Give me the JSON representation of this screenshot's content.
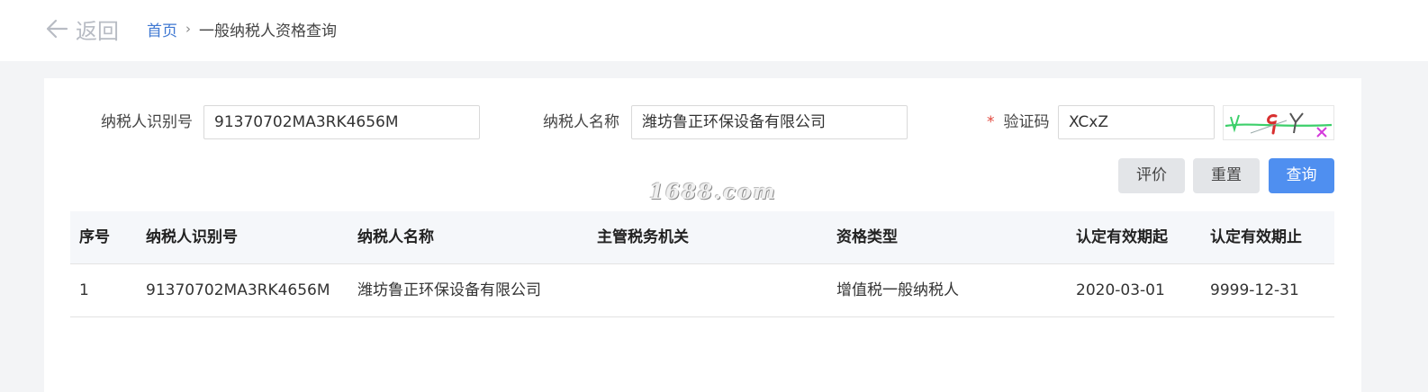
{
  "header": {
    "back_label": "返回",
    "breadcrumb": {
      "home": "首页",
      "separator": "›",
      "current": "一般纳税人资格查询"
    }
  },
  "form": {
    "taxpayer_id": {
      "label": "纳税人识别号",
      "value": "91370702MA3RK4656M"
    },
    "taxpayer_name": {
      "label": "纳税人名称",
      "value": "潍坊鲁正环保设备有限公司"
    },
    "captcha": {
      "required_mark": "*",
      "label": "验证码",
      "value": "XCxZ"
    },
    "buttons": {
      "evaluate": "评价",
      "reset": "重置",
      "query": "查询"
    }
  },
  "watermark": "1688.com",
  "table": {
    "columns": [
      "序号",
      "纳税人识别号",
      "纳税人名称",
      "主管税务机关",
      "资格类型",
      "认定有效期起",
      "认定有效期止"
    ],
    "rows": [
      [
        "1",
        "91370702MA3RK4656M",
        "潍坊鲁正环保设备有限公司",
        "",
        "增值税一般纳税人",
        "2020-03-01",
        "9999-12-31"
      ]
    ]
  },
  "colors": {
    "primary": "#4f8ff0",
    "link": "#3f78d2",
    "required": "#e2483d",
    "page_bg": "#f3f4f6"
  }
}
